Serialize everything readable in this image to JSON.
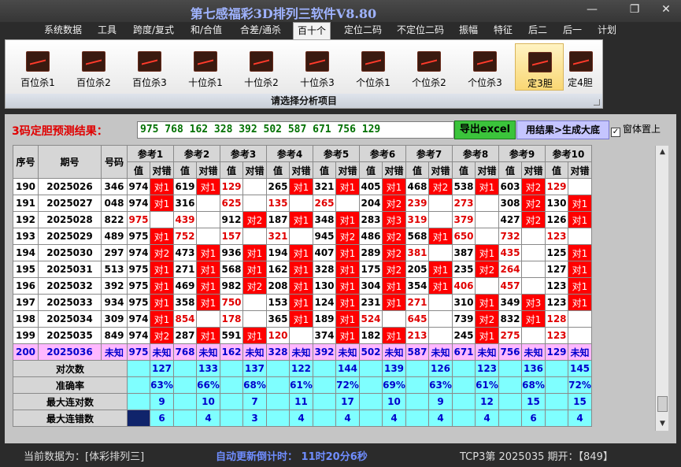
{
  "window": {
    "title": "第七感福彩3D排列三软件V8.80",
    "minimize_glyph": "—",
    "restore_glyph": "❐",
    "close_glyph": "✕"
  },
  "menu": [
    {
      "label": "系统数据",
      "active": false
    },
    {
      "label": "工具",
      "active": false
    },
    {
      "label": "跨度/复式",
      "active": false
    },
    {
      "label": "和/合值",
      "active": false
    },
    {
      "label": "合差/通杀",
      "active": false
    },
    {
      "label": "百十个",
      "active": true
    },
    {
      "label": "定位二码",
      "active": false
    },
    {
      "label": "不定位二码",
      "active": false
    },
    {
      "label": "振幅",
      "active": false
    },
    {
      "label": "特征",
      "active": false
    },
    {
      "label": "后二",
      "active": false
    },
    {
      "label": "后一",
      "active": false
    },
    {
      "label": "计划",
      "active": false
    }
  ],
  "toolbar": {
    "buttons": [
      {
        "label": "百位杀1",
        "active": false
      },
      {
        "label": "百位杀2",
        "active": false
      },
      {
        "label": "百位杀3",
        "active": false
      },
      {
        "label": "十位杀1",
        "active": false
      },
      {
        "label": "十位杀2",
        "active": false
      },
      {
        "label": "十位杀3",
        "active": false
      },
      {
        "label": "个位杀1",
        "active": false
      },
      {
        "label": "个位杀2",
        "active": false
      },
      {
        "label": "个位杀3",
        "active": false
      },
      {
        "label": "定3胆",
        "active": true
      },
      {
        "label": "定4胆",
        "active": false
      }
    ],
    "icon_name": "chart-line-icon",
    "caption": "请选择分析项目"
  },
  "prediction": {
    "label": "3码定胆预测结果：",
    "value": "975 768 162 328 392 502 587 671 756 129",
    "export_label": "导出excel",
    "generate_label": "用结果>生成大底",
    "topmost_label": "窗体置上",
    "topmost_checked": true
  },
  "grid": {
    "headers": {
      "seq": "序号",
      "period": "期号",
      "number": "号码"
    },
    "ref_labels": [
      "参考1",
      "参考2",
      "参考3",
      "参考4",
      "参考5",
      "参考6",
      "参考7",
      "参考8",
      "参考9",
      "参考10"
    ],
    "sub_value": "值",
    "sub_result": "对错",
    "rows": [
      {
        "seq": "190",
        "period": "2025026",
        "num": "346",
        "cells": [
          [
            "974",
            false,
            "对1"
          ],
          [
            "619",
            false,
            "对1"
          ],
          [
            "129",
            true,
            ""
          ],
          [
            "265",
            false,
            "对1"
          ],
          [
            "321",
            false,
            "对1"
          ],
          [
            "405",
            false,
            "对1"
          ],
          [
            "468",
            false,
            "对2"
          ],
          [
            "538",
            false,
            "对1"
          ],
          [
            "603",
            false,
            "对2"
          ],
          [
            "129",
            true,
            ""
          ]
        ]
      },
      {
        "seq": "191",
        "period": "2025027",
        "num": "048",
        "cells": [
          [
            "974",
            false,
            "对1"
          ],
          [
            "316",
            false,
            ""
          ],
          [
            "625",
            true,
            ""
          ],
          [
            "135",
            true,
            ""
          ],
          [
            "265",
            true,
            ""
          ],
          [
            "204",
            false,
            "对2"
          ],
          [
            "239",
            true,
            ""
          ],
          [
            "273",
            true,
            ""
          ],
          [
            "308",
            false,
            "对2"
          ],
          [
            "130",
            false,
            "对1"
          ]
        ]
      },
      {
        "seq": "192",
        "period": "2025028",
        "num": "822",
        "cells": [
          [
            "975",
            true,
            ""
          ],
          [
            "439",
            true,
            ""
          ],
          [
            "912",
            false,
            "对2"
          ],
          [
            "187",
            false,
            "对1"
          ],
          [
            "348",
            false,
            "对1"
          ],
          [
            "283",
            false,
            "对3"
          ],
          [
            "319",
            true,
            ""
          ],
          [
            "379",
            true,
            ""
          ],
          [
            "427",
            false,
            "对2"
          ],
          [
            "126",
            false,
            "对1"
          ]
        ]
      },
      {
        "seq": "193",
        "period": "2025029",
        "num": "489",
        "cells": [
          [
            "975",
            false,
            "对1"
          ],
          [
            "752",
            true,
            ""
          ],
          [
            "157",
            true,
            ""
          ],
          [
            "321",
            true,
            ""
          ],
          [
            "945",
            false,
            "对2"
          ],
          [
            "486",
            false,
            "对2"
          ],
          [
            "568",
            false,
            "对1"
          ],
          [
            "650",
            true,
            ""
          ],
          [
            "732",
            true,
            ""
          ],
          [
            "123",
            true,
            ""
          ]
        ]
      },
      {
        "seq": "194",
        "period": "2025030",
        "num": "297",
        "cells": [
          [
            "974",
            false,
            "对2"
          ],
          [
            "473",
            false,
            "对1"
          ],
          [
            "936",
            false,
            "对1"
          ],
          [
            "194",
            false,
            "对1"
          ],
          [
            "407",
            false,
            "对1"
          ],
          [
            "289",
            false,
            "对2"
          ],
          [
            "381",
            true,
            ""
          ],
          [
            "387",
            false,
            "对1"
          ],
          [
            "435",
            true,
            ""
          ],
          [
            "125",
            false,
            "对1"
          ]
        ]
      },
      {
        "seq": "195",
        "period": "2025031",
        "num": "513",
        "cells": [
          [
            "975",
            false,
            "对1"
          ],
          [
            "271",
            false,
            "对1"
          ],
          [
            "568",
            false,
            "对1"
          ],
          [
            "162",
            false,
            "对1"
          ],
          [
            "328",
            false,
            "对1"
          ],
          [
            "175",
            false,
            "对2"
          ],
          [
            "205",
            false,
            "对1"
          ],
          [
            "235",
            false,
            "对2"
          ],
          [
            "264",
            true,
            ""
          ],
          [
            "127",
            false,
            "对1"
          ]
        ]
      },
      {
        "seq": "196",
        "period": "2025032",
        "num": "392",
        "cells": [
          [
            "975",
            false,
            "对1"
          ],
          [
            "469",
            false,
            "对1"
          ],
          [
            "982",
            false,
            "对2"
          ],
          [
            "208",
            false,
            "对1"
          ],
          [
            "130",
            false,
            "对1"
          ],
          [
            "304",
            false,
            "对1"
          ],
          [
            "354",
            false,
            "对1"
          ],
          [
            "406",
            true,
            ""
          ],
          [
            "457",
            true,
            ""
          ],
          [
            "123",
            false,
            "对1"
          ]
        ]
      },
      {
        "seq": "197",
        "period": "2025033",
        "num": "934",
        "cells": [
          [
            "975",
            false,
            "对1"
          ],
          [
            "358",
            false,
            "对1"
          ],
          [
            "750",
            true,
            ""
          ],
          [
            "153",
            false,
            "对1"
          ],
          [
            "124",
            false,
            "对1"
          ],
          [
            "231",
            false,
            "对1"
          ],
          [
            "271",
            true,
            ""
          ],
          [
            "310",
            false,
            "对1"
          ],
          [
            "349",
            false,
            "对3"
          ],
          [
            "123",
            false,
            "对1"
          ]
        ]
      },
      {
        "seq": "198",
        "period": "2025034",
        "num": "309",
        "cells": [
          [
            "974",
            false,
            "对1"
          ],
          [
            "854",
            true,
            ""
          ],
          [
            "178",
            true,
            ""
          ],
          [
            "365",
            false,
            "对1"
          ],
          [
            "189",
            false,
            "对1"
          ],
          [
            "524",
            true,
            ""
          ],
          [
            "645",
            true,
            ""
          ],
          [
            "739",
            false,
            "对2"
          ],
          [
            "832",
            false,
            "对1"
          ],
          [
            "128",
            true,
            ""
          ]
        ]
      },
      {
        "seq": "199",
        "period": "2025035",
        "num": "849",
        "cells": [
          [
            "974",
            false,
            "对2"
          ],
          [
            "287",
            false,
            "对1"
          ],
          [
            "591",
            false,
            "对1"
          ],
          [
            "120",
            true,
            ""
          ],
          [
            "374",
            false,
            "对1"
          ],
          [
            "182",
            false,
            "对1"
          ],
          [
            "213",
            true,
            ""
          ],
          [
            "245",
            false,
            "对1"
          ],
          [
            "275",
            true,
            ""
          ],
          [
            "123",
            true,
            ""
          ]
        ]
      }
    ],
    "last_row": {
      "seq": "200",
      "period": "2025036",
      "num": "未知",
      "values": [
        "975",
        "768",
        "162",
        "328",
        "392",
        "502",
        "587",
        "671",
        "756",
        "129"
      ],
      "result": "未知"
    },
    "stats": [
      {
        "label": "对次数",
        "values": [
          "127",
          "133",
          "137",
          "122",
          "144",
          "139",
          "126",
          "123",
          "136",
          "145"
        ]
      },
      {
        "label": "准确率",
        "values": [
          "63%",
          "66%",
          "68%",
          "61%",
          "72%",
          "69%",
          "63%",
          "61%",
          "68%",
          "72%"
        ]
      },
      {
        "label": "最大连对数",
        "values": [
          "9",
          "10",
          "7",
          "11",
          "17",
          "10",
          "9",
          "12",
          "15",
          "15"
        ]
      },
      {
        "label": "最大连错数",
        "values": [
          "6",
          "4",
          "3",
          "4",
          "4",
          "4",
          "4",
          "4",
          "6",
          "4"
        ]
      }
    ]
  },
  "status": {
    "current_data": "当前数据为：[体彩排列三]",
    "countdown": "自动更新倒计时：  11时20分6秒",
    "tcp": "TCP3第 2025035 期开：【849】"
  }
}
